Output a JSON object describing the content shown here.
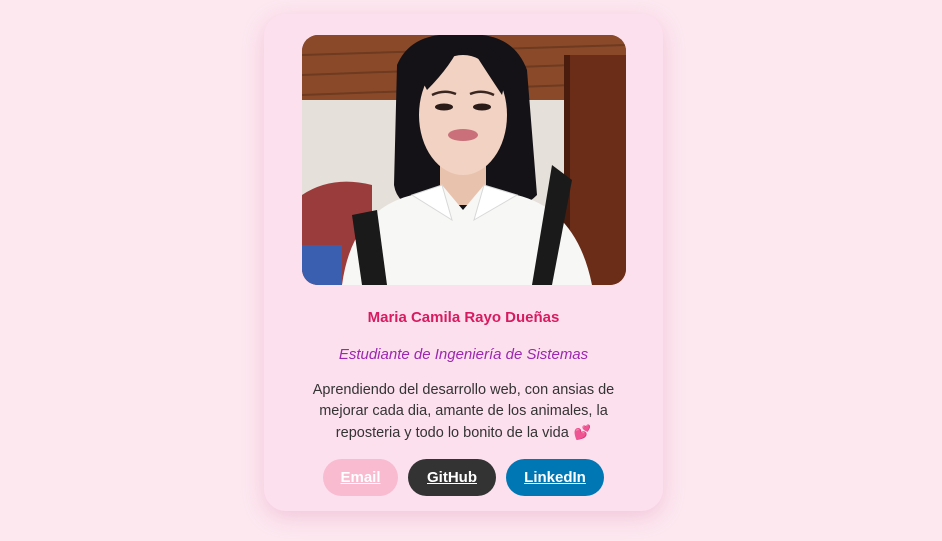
{
  "profile": {
    "name": "Maria Camila Rayo Dueñas",
    "role": "Estudiante de Ingeniería de Sistemas",
    "bio": "Aprendiendo del desarrollo web, con ansias de mejorar cada dia, amante de los animales, la reposteria y todo lo bonito de la vida",
    "bio_emoji": "💕"
  },
  "links": {
    "email_label": "Email",
    "github_label": "GitHub",
    "linkedin_label": "LinkedIn"
  },
  "colors": {
    "page_background": "#fde8f0",
    "card_background": "#fde0ee",
    "name": "#d81b60",
    "role": "#9c27b0",
    "email_button": "#f8bbd0",
    "github_button": "#333333",
    "linkedin_button": "#0077b5"
  }
}
